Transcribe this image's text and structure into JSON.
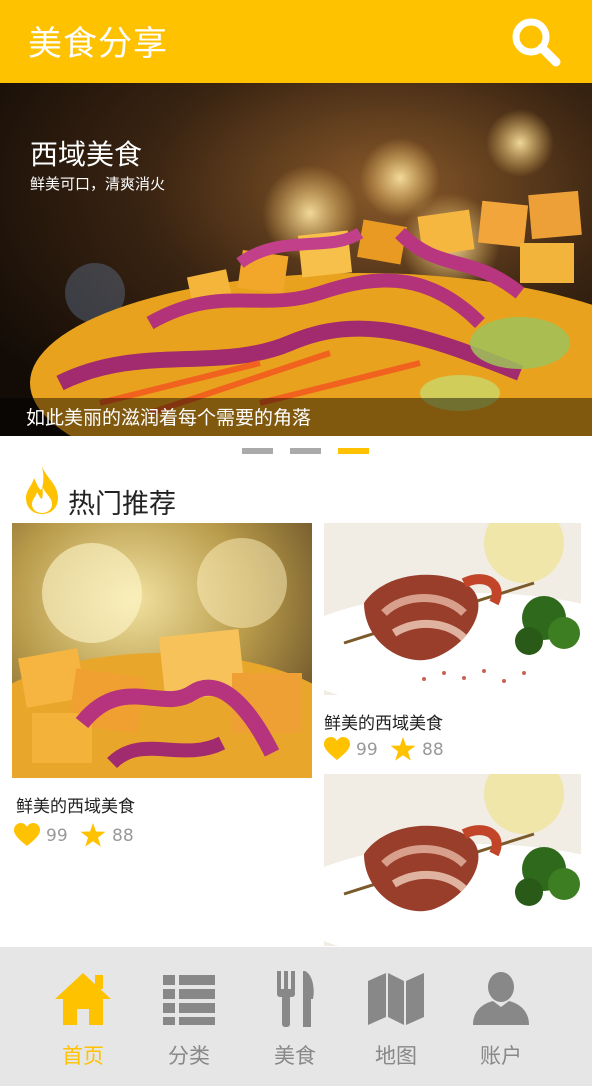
{
  "header": {
    "title": "美食分享",
    "search_icon": "search-icon"
  },
  "banner": {
    "title": "西域美食",
    "subtitle": "鲜美可口，清爽消火",
    "caption": "如此美丽的滋润着每个需要的角落",
    "slide_count": 3,
    "active_slide": 3
  },
  "section": {
    "title": "热门推荐",
    "icon": "flame-icon"
  },
  "cards": [
    {
      "name": "鲜美的西域美食",
      "likes": "99",
      "stars": "88"
    },
    {
      "name": "鲜美的西域美食",
      "likes": "99",
      "stars": "88"
    },
    {
      "name": "",
      "likes": "",
      "stars": ""
    }
  ],
  "tabs": [
    {
      "label": "首页",
      "icon": "home-icon",
      "active": true
    },
    {
      "label": "分类",
      "icon": "list-icon",
      "active": false
    },
    {
      "label": "美食",
      "icon": "fork-knife-icon",
      "active": false
    },
    {
      "label": "地图",
      "icon": "map-icon",
      "active": false
    },
    {
      "label": "账户",
      "icon": "user-icon",
      "active": false
    }
  ],
  "colors": {
    "accent": "#ffc200",
    "tab_bg": "#e6e6e6",
    "inactive": "#888888"
  }
}
